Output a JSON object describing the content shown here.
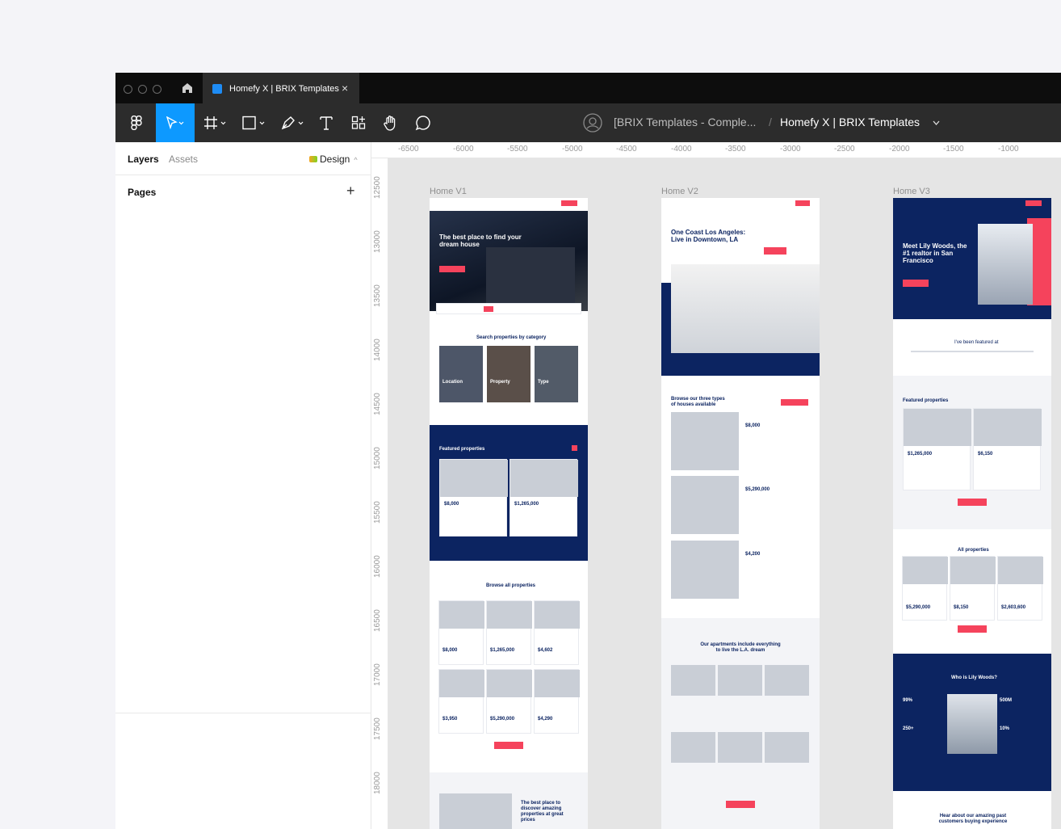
{
  "tabbar": {
    "tab_title": "Homefy X | BRIX Templates",
    "tab_close": "×"
  },
  "toolbar": {
    "breadcrumb_team": "[BRIX Templates - Comple...",
    "breadcrumb_sep": "/",
    "breadcrumb_file": "Homefy X | BRIX Templates"
  },
  "left_panel": {
    "tab_layers": "Layers",
    "tab_assets": "Assets",
    "design_label": "Design",
    "pages_label": "Pages",
    "add_page": "+"
  },
  "rulers": {
    "horizontal": [
      "-6500",
      "-6000",
      "-5500",
      "-5000",
      "-4500",
      "-4000",
      "-3500",
      "-3000",
      "-2500",
      "-2000",
      "-1500",
      "-1000"
    ],
    "vertical": [
      "12500",
      "13000",
      "13500",
      "14000",
      "14500",
      "15000",
      "15500",
      "16000",
      "16500",
      "17000",
      "17500",
      "18000"
    ]
  },
  "frames": [
    {
      "label": "Home V1",
      "hero": "The best place to find your dream house",
      "category_title": "Search properties by category",
      "categories": [
        "Location",
        "Property",
        "Type"
      ],
      "featured_title": "Featured properties",
      "featured_prices": [
        "$8,000",
        "$1,265,000"
      ],
      "browse_title": "Browse all properties",
      "prices": [
        "$8,000",
        "$1,265,000",
        "$4,602",
        "$3,950",
        "$5,290,000",
        "$4,290"
      ],
      "bottom_title": "The best place to discover amazing properties at great prices"
    },
    {
      "label": "Home V2",
      "hero": "One Coast Los Angeles: Live in Downtown, LA",
      "browse_title": "Browse our three types of houses available",
      "prices": [
        "$8,000",
        "$5,290,000",
        "$4,200"
      ],
      "apartments_title": "Our apartments include everything to live the L.A. dream"
    },
    {
      "label": "Home V3",
      "hero": "Meet Lily Woods, the #1 realtor in San Francisco",
      "featured_in": "I've been featured at",
      "featured_title": "Featured properties",
      "featured_prices": [
        "$1,265,000",
        "$6,150"
      ],
      "all_title": "All properties",
      "prices": [
        "$5,290,000",
        "$8,150",
        "$2,603,600"
      ],
      "who_title": "Who is Lily Woods?",
      "stats": [
        "99%",
        "500M",
        "250+",
        "10%"
      ],
      "bottom_title": "Hear about our amazing past customers buying experience"
    }
  ],
  "colors": {
    "accent": "#0d99ff",
    "navy": "#0c2461",
    "brand_pink": "#f5435c",
    "toolbar": "#2c2c2c"
  }
}
